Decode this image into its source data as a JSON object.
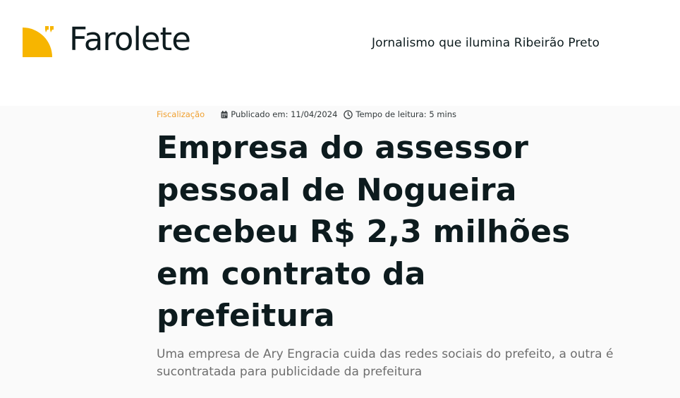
{
  "header": {
    "logo_text": "Farolete",
    "tagline": "Jornalismo que ilumina Ribeirão Preto",
    "brand_color": "#F7B500"
  },
  "article": {
    "category": "Fiscalização",
    "published": "Publicado em: 11/04/2024",
    "reading_time": "Tempo de leitura: 5 mins",
    "headline": "Empresa do assessor pessoal de Nogueira recebeu R$ 2,3 milhões em contrato da prefeitura",
    "subtitle": "Uma empresa de Ary Engracia cuida das redes sociais do prefeito, a outra é sucontratada para publicidade da prefeitura",
    "category_color": "#F0A030",
    "icons": {
      "published": "calendar-icon",
      "reading_time": "clock-icon"
    }
  }
}
